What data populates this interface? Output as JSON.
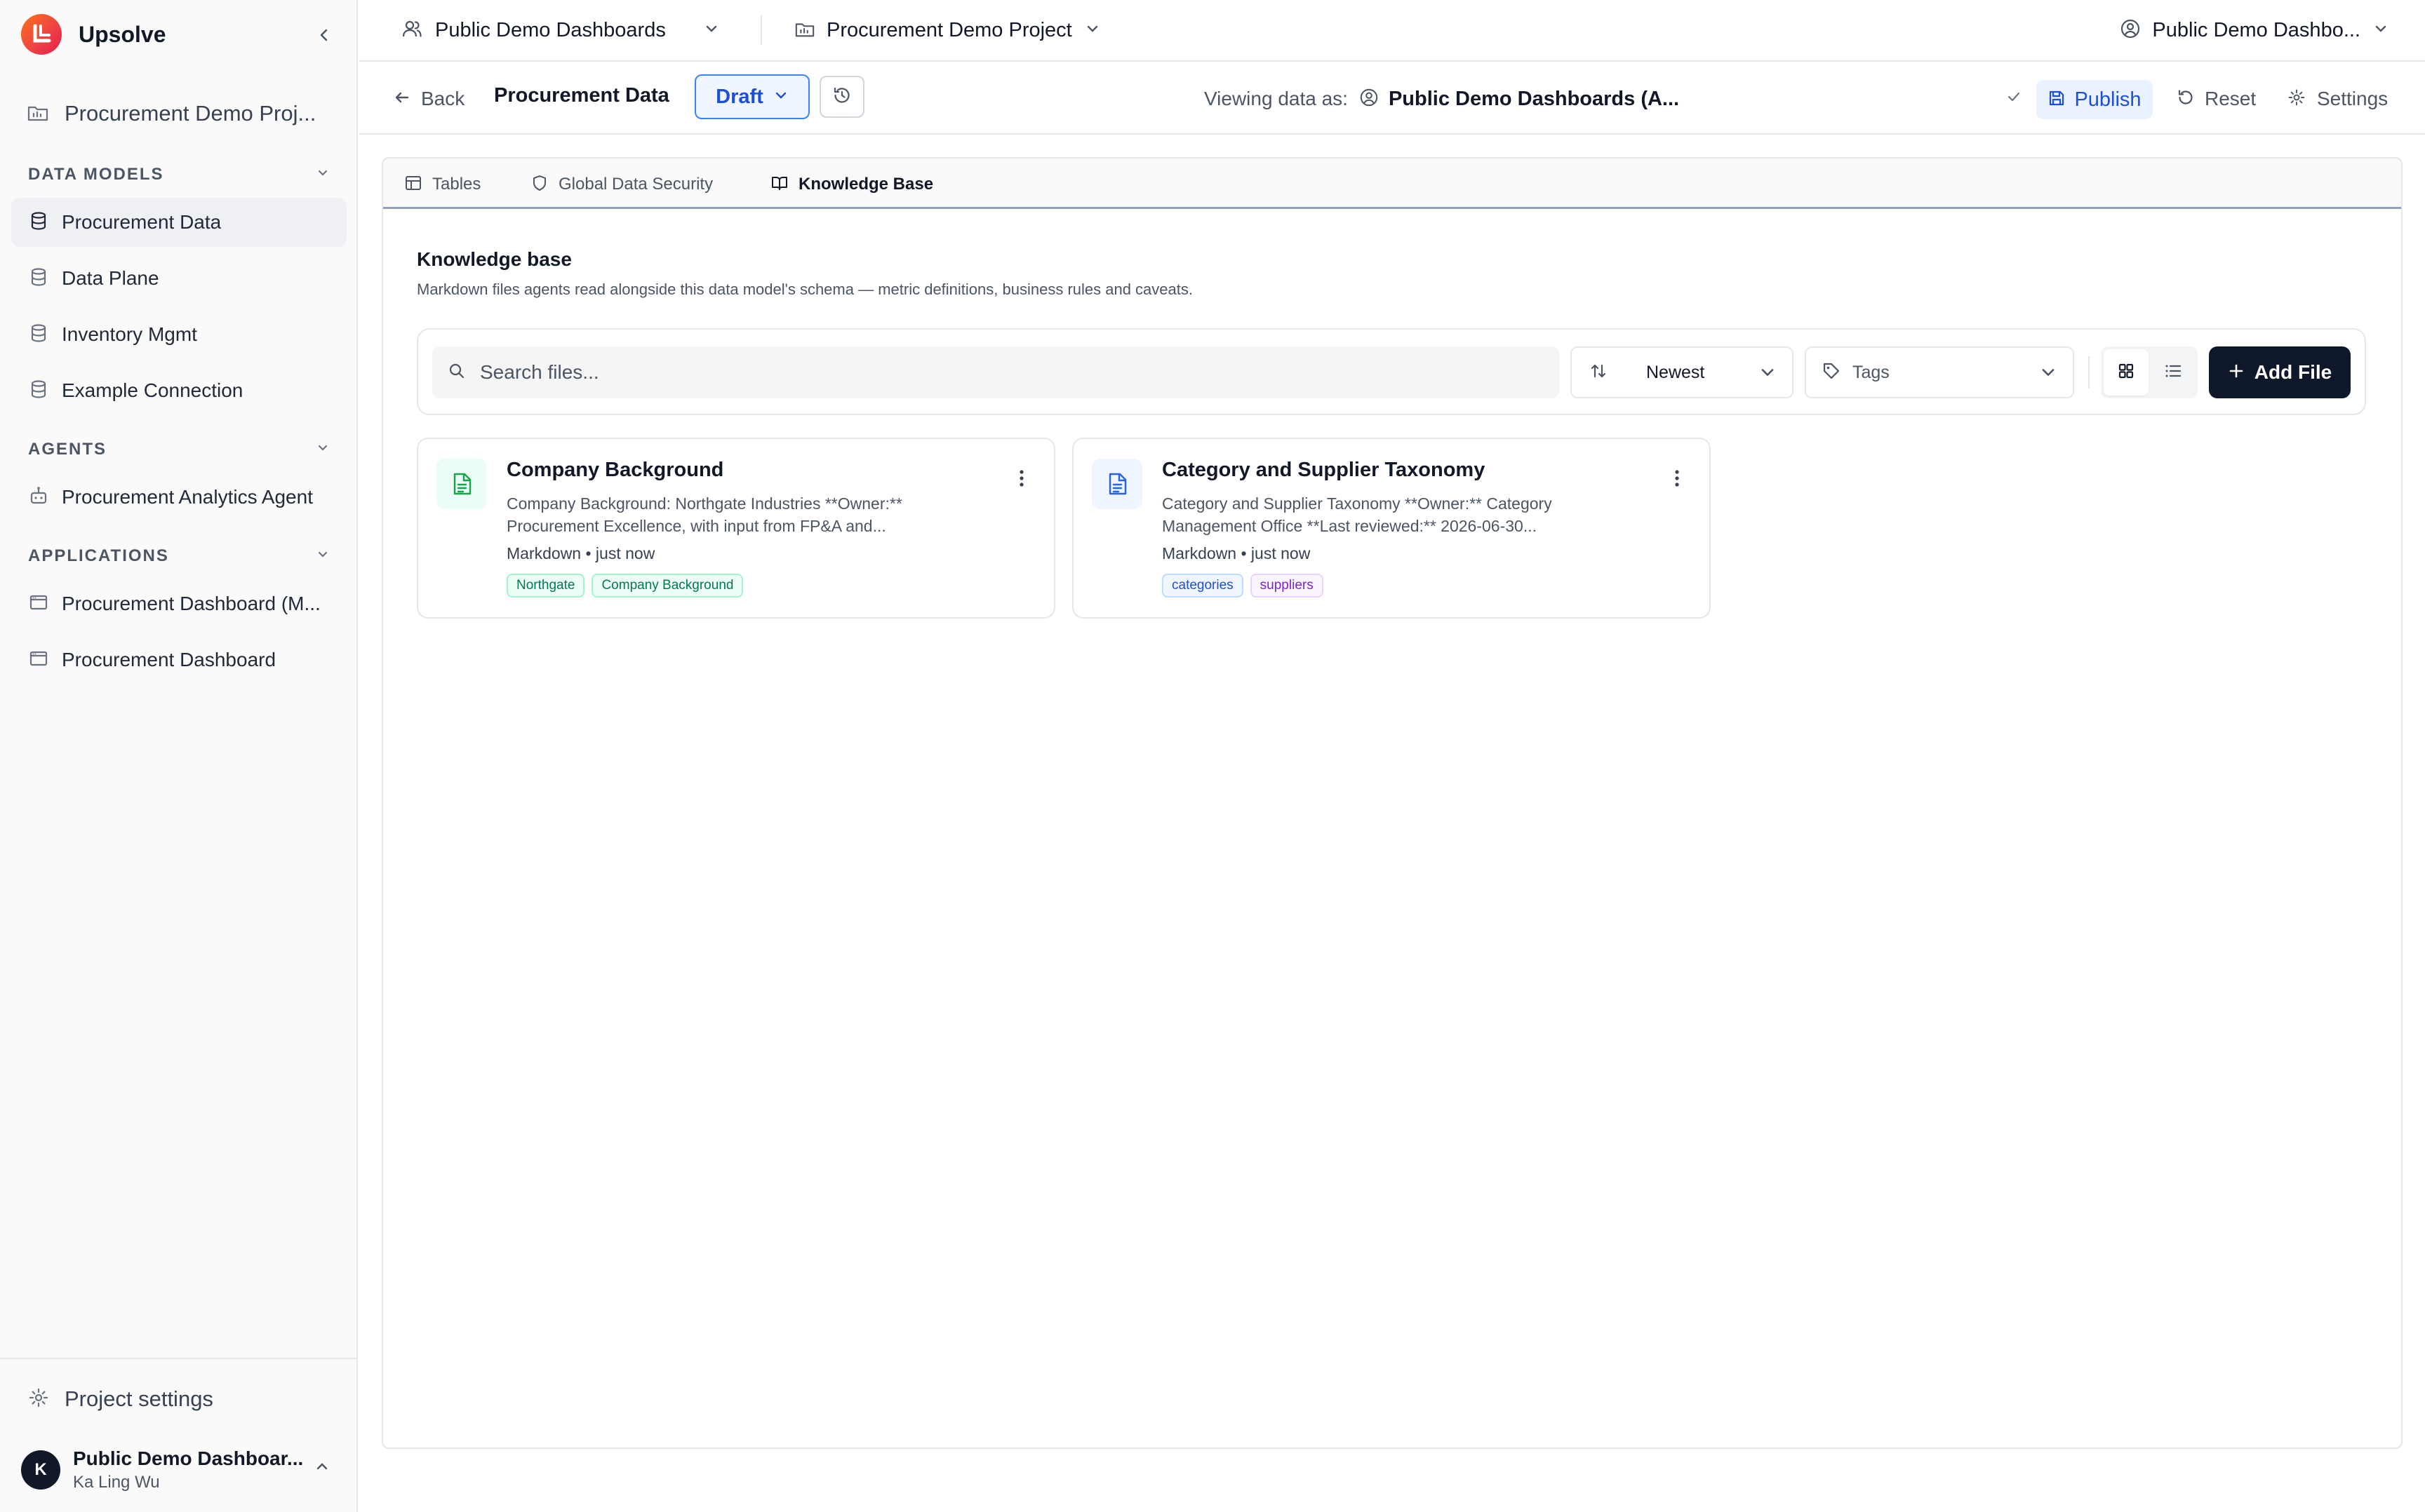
{
  "brand": {
    "name": "Upsolve"
  },
  "sidebar": {
    "project": "Procurement Demo Proj...",
    "sections": {
      "data_models": "DATA MODELS",
      "agents": "AGENTS",
      "applications": "APPLICATIONS"
    },
    "data_models": [
      {
        "label": "Procurement Data",
        "active": true
      },
      {
        "label": "Data Plane"
      },
      {
        "label": "Inventory Mgmt"
      },
      {
        "label": "Example Connection"
      }
    ],
    "agents": [
      {
        "label": "Procurement Analytics Agent"
      }
    ],
    "applications": [
      {
        "label": "Procurement Dashboard (M..."
      },
      {
        "label": "Procurement Dashboard"
      }
    ],
    "project_settings": "Project settings",
    "user": {
      "initial": "K",
      "name": "Public Demo Dashboar...",
      "sub": "Ka Ling Wu"
    }
  },
  "topbar": {
    "org": "Public Demo Dashboards",
    "project": "Procurement Demo Project",
    "account": "Public Demo Dashbo..."
  },
  "toolbar": {
    "back": "Back",
    "model_title": "Procurement Data",
    "draft": "Draft",
    "viewing_label": "Viewing data as:",
    "viewing_as": "Public Demo Dashboards (A...",
    "publish": "Publish",
    "reset": "Reset",
    "settings": "Settings"
  },
  "tabs": [
    {
      "label": "Tables"
    },
    {
      "label": "Global Data Security"
    },
    {
      "label": "Knowledge Base",
      "active": true
    }
  ],
  "knowledge_base": {
    "title": "Knowledge base",
    "description": "Markdown files agents read alongside this data model's schema — metric definitions, business rules and caveats.",
    "search_placeholder": "Search files...",
    "sort": "Newest",
    "tags_placeholder": "Tags",
    "add_file": "Add File"
  },
  "files": [
    {
      "title": "Company Background",
      "snippet": "Company Background: Northgate Industries **Owner:** Procurement Excellence, with input from FP&A and...",
      "meta": "Markdown • just now",
      "icon_color": "#16a34a",
      "tags": [
        "Northgate",
        "Company Background"
      ]
    },
    {
      "title": "Category and Supplier Taxonomy",
      "snippet": "Category and Supplier Taxonomy **Owner:** Category Management Office **Last reviewed:** 2026-06-30...",
      "meta": "Markdown • just now",
      "icon_color": "#2563eb",
      "tags": [
        "categories",
        "suppliers"
      ]
    }
  ],
  "colors": {
    "accent": "#1d4ed8",
    "primary_button": "#0f172a",
    "tag_green": "#047857",
    "tag_blue": "#1d4ed8",
    "tag_purple": "#7e22ce"
  }
}
